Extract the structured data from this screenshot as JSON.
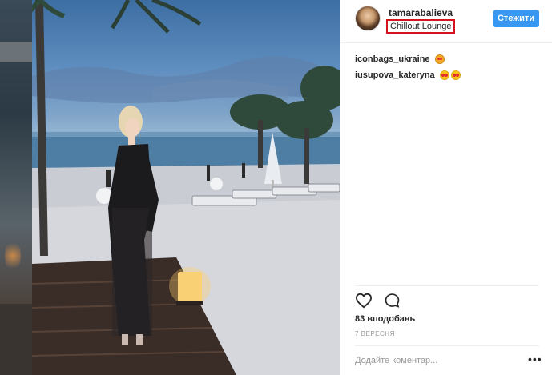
{
  "post": {
    "author": {
      "username": "tamarabalieva",
      "location": "Chillout Lounge",
      "follow_label": "Стежити"
    },
    "comments": [
      {
        "username": "iconbags_ukraine",
        "emojis": [
          "cat-heart-eyes"
        ]
      },
      {
        "username": "iusupova_kateryna",
        "emojis": [
          "heart-eyes",
          "heart-eyes"
        ]
      }
    ],
    "likes": "83 вподобань",
    "date": "7 ВЕРЕСНЯ",
    "comment_placeholder": "Додайте коментар...",
    "more_label": "•••"
  },
  "colors": {
    "follow_button": "#3897f0",
    "location_highlight": "#d4131b"
  }
}
